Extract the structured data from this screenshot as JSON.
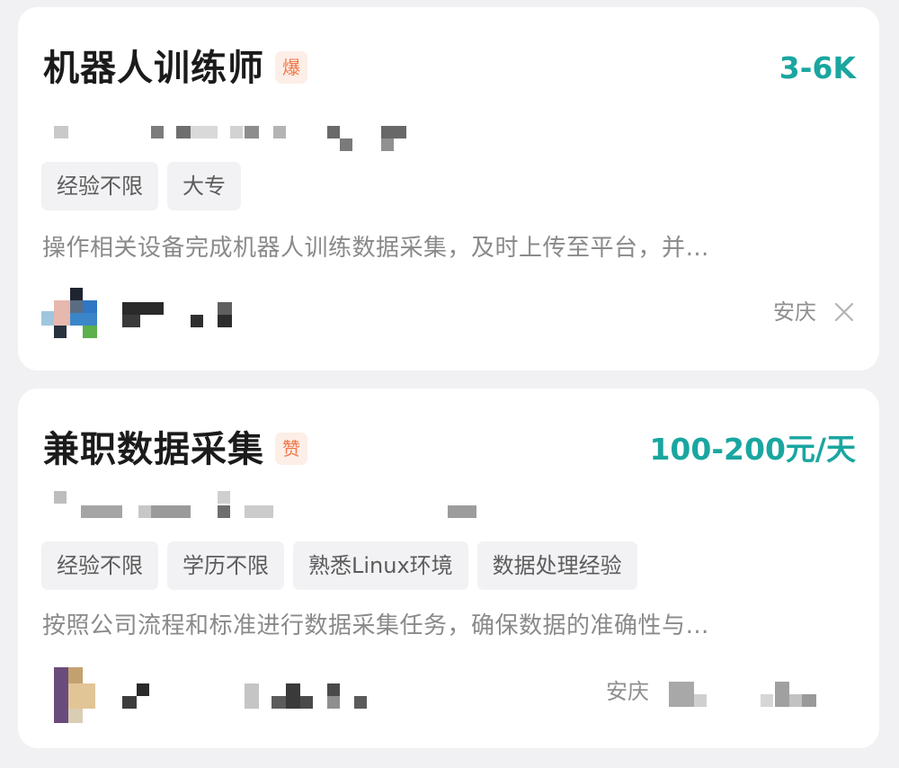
{
  "jobs": [
    {
      "title": "机器人训练师",
      "badge": "爆",
      "salary": "3-6K",
      "tags": [
        "经验不限",
        "大专"
      ],
      "description": "操作相关设备完成机器人训练数据采集，及时上传至平台，并…",
      "location": "安庆",
      "colors": {
        "badge_bg": "#fdeee7",
        "badge_text": "#ef7849",
        "salary": "#1aa6a0"
      }
    },
    {
      "title": "兼职数据采集",
      "badge": "赞",
      "salary": "100-200元/天",
      "tags": [
        "经验不限",
        "学历不限",
        "熟悉Linux环境",
        "数据处理经验"
      ],
      "description": "按照公司流程和标准进行数据采集任务，确保数据的准确性与…",
      "location": "安庆",
      "colors": {
        "badge_bg": "#fdeee7",
        "badge_text": "#ef7849",
        "salary": "#1aa6a0"
      }
    }
  ],
  "icons": {
    "close": "close-icon",
    "avatar": "avatar"
  }
}
